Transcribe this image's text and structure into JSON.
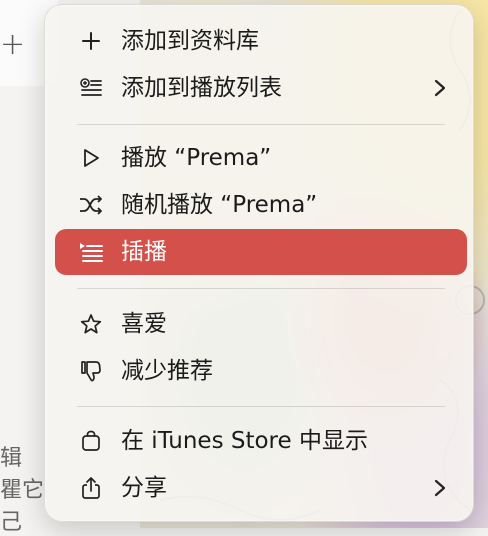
{
  "background": {
    "plus_glyph": "+",
    "side_text_1": "辑",
    "side_text_2": "瞿它",
    "side_text_3": "己"
  },
  "menu": {
    "items": [
      {
        "label": "添加到资料库",
        "icon": "plus-icon",
        "submenu": false
      },
      {
        "label": "添加到播放列表",
        "icon": "add-to-playlist-icon",
        "submenu": true
      },
      {
        "label": "播放 “Prema”",
        "icon": "play-icon",
        "submenu": false
      },
      {
        "label": "随机播放 “Prema”",
        "icon": "shuffle-icon",
        "submenu": false
      },
      {
        "label": "插播",
        "icon": "play-next-icon",
        "submenu": false,
        "highlighted": true
      },
      {
        "label": "喜爱",
        "icon": "star-icon",
        "submenu": false
      },
      {
        "label": "减少推荐",
        "icon": "thumbs-down-icon",
        "submenu": false
      },
      {
        "label": "在 iTunes Store 中显示",
        "icon": "shopping-bag-icon",
        "submenu": false
      },
      {
        "label": "分享",
        "icon": "share-icon",
        "submenu": true
      }
    ]
  },
  "colors": {
    "highlight": "#d4504a",
    "text": "#1b1b1b",
    "highlight_text": "#ffffff"
  }
}
